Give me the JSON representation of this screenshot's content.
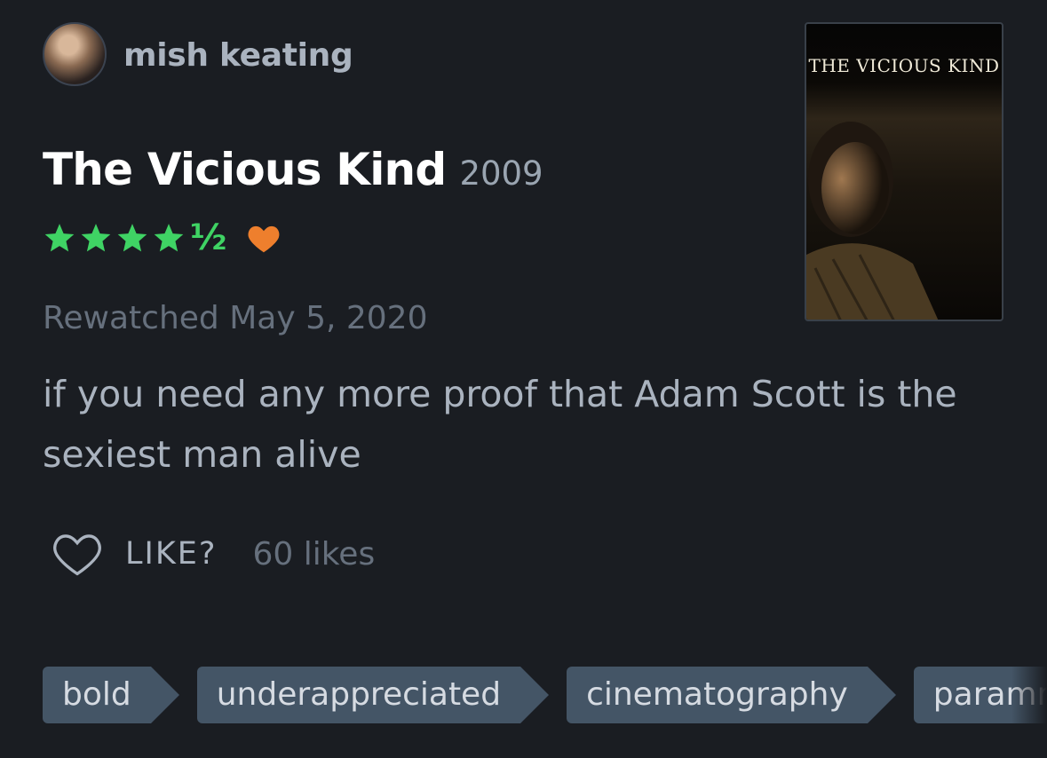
{
  "user": {
    "name": "mish keating"
  },
  "film": {
    "title": "The Vicious Kind",
    "year": "2009",
    "poster_title": "THE VICIOUS KIND"
  },
  "rating": {
    "stars": 4.5,
    "half_glyph": "½",
    "liked": true
  },
  "watched": "Rewatched May 5, 2020",
  "review": "if you need any more proof that Adam Scott is the sexiest man alive",
  "likes": {
    "label": "LIKE?",
    "count": "60 likes"
  },
  "tags": [
    "bold",
    "underappreciated",
    "cinematography",
    "paramnesia"
  ],
  "colors": {
    "background": "#1a1d22",
    "star_green": "#3fd364",
    "heart_orange": "#ee7f2d",
    "tag_bg": "#445566"
  }
}
